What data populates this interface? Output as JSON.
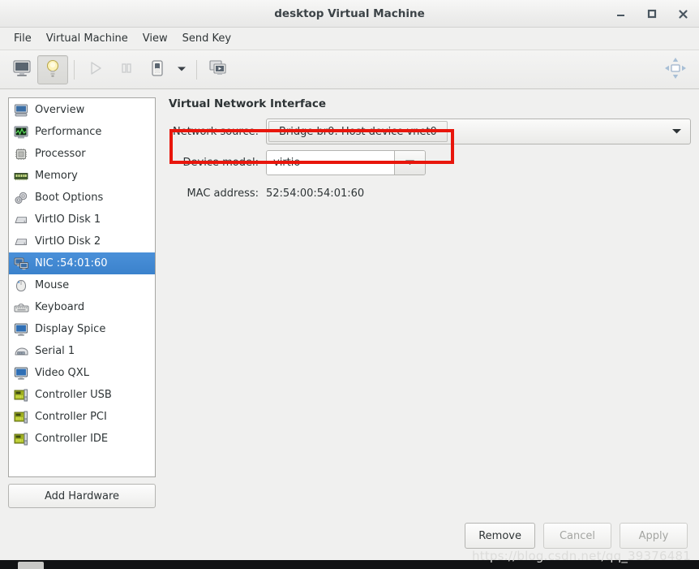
{
  "window": {
    "title": "desktop Virtual Machine",
    "minimize_label": "minimize",
    "maximize_label": "maximize",
    "close_label": "close"
  },
  "menubar": {
    "items": [
      {
        "label": "File"
      },
      {
        "label": "Virtual Machine"
      },
      {
        "label": "View"
      },
      {
        "label": "Send Key"
      }
    ]
  },
  "toolbar": {
    "buttons": [
      {
        "name": "show-console-button",
        "icon": "monitor-icon",
        "state": "normal"
      },
      {
        "name": "show-details-button",
        "icon": "lightbulb-icon",
        "state": "active"
      },
      {
        "name": "run-button",
        "icon": "play-icon",
        "state": "disabled"
      },
      {
        "name": "pause-button",
        "icon": "pause-icon",
        "state": "disabled"
      },
      {
        "name": "shutdown-button",
        "icon": "power-switch-icon",
        "state": "normal"
      },
      {
        "name": "shutdown-menu-button",
        "icon": "chevron-down-icon",
        "state": "normal"
      },
      {
        "name": "snapshots-button",
        "icon": "screens-icon",
        "state": "normal"
      }
    ],
    "fullscreen_button": {
      "name": "resize-to-vm-button",
      "icon": "resize-arrows-icon"
    }
  },
  "sidebar": {
    "items": [
      {
        "label": "Overview",
        "icon": "computer-icon",
        "selected": false
      },
      {
        "label": "Performance",
        "icon": "graph-icon",
        "selected": false
      },
      {
        "label": "Processor",
        "icon": "cpu-icon",
        "selected": false
      },
      {
        "label": "Memory",
        "icon": "memory-icon",
        "selected": false
      },
      {
        "label": "Boot Options",
        "icon": "gears-icon",
        "selected": false
      },
      {
        "label": "VirtIO Disk 1",
        "icon": "harddisk-icon",
        "selected": false
      },
      {
        "label": "VirtIO Disk 2",
        "icon": "harddisk-icon",
        "selected": false
      },
      {
        "label": "NIC :54:01:60",
        "icon": "network-icon",
        "selected": true
      },
      {
        "label": "Mouse",
        "icon": "mouse-icon",
        "selected": false
      },
      {
        "label": "Keyboard",
        "icon": "keyboard-icon",
        "selected": false
      },
      {
        "label": "Display Spice",
        "icon": "display-icon",
        "selected": false
      },
      {
        "label": "Serial 1",
        "icon": "serial-icon",
        "selected": false
      },
      {
        "label": "Video QXL",
        "icon": "display-icon",
        "selected": false
      },
      {
        "label": "Controller USB",
        "icon": "controller-icon",
        "selected": false
      },
      {
        "label": "Controller PCI",
        "icon": "controller-icon",
        "selected": false
      },
      {
        "label": "Controller IDE",
        "icon": "controller-icon",
        "selected": false
      }
    ],
    "add_hardware_label": "Add Hardware"
  },
  "main": {
    "panel_title": "Virtual Network Interface",
    "network_source": {
      "label": "Network source:",
      "value": "Bridge br0: Host device vnet0"
    },
    "device_model": {
      "label": "Device model:",
      "value": "virtio"
    },
    "mac_address": {
      "label": "MAC address:",
      "value": "52:54:00:54:01:60"
    }
  },
  "footer": {
    "remove_label": "Remove",
    "cancel_label": "Cancel",
    "apply_label": "Apply"
  },
  "watermark": {
    "text": "https://blog.csdn.net/qq_39376481"
  },
  "colors": {
    "selection_blue": "#4a90d9",
    "annotation_red": "#e8160c",
    "window_bg": "#f0f0ef",
    "list_bg": "#ffffff"
  }
}
